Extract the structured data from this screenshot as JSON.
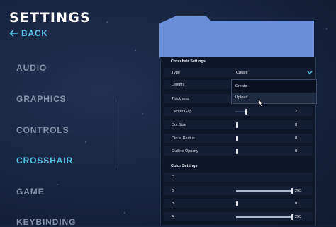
{
  "header": {
    "title": "SETTINGS",
    "back_label": "BACK",
    "back_icon": "arrow-left-icon",
    "accent_color": "#59c6e8"
  },
  "nav": {
    "items": [
      {
        "label": "AUDIO",
        "active": false
      },
      {
        "label": "GRAPHICS",
        "active": false
      },
      {
        "label": "CONTROLS",
        "active": false
      },
      {
        "label": "CROSSHAIR",
        "active": true
      },
      {
        "label": "GAME",
        "active": false
      },
      {
        "label": "KEYBINDING",
        "active": false
      }
    ]
  },
  "crosshair_settings": {
    "title": "Crosshair Settings",
    "type": {
      "label": "Type",
      "selected": "Create",
      "options": [
        "Create",
        "Upload"
      ],
      "hovered_option": "Upload"
    },
    "length": {
      "label": "Length"
    },
    "thickness": {
      "label": "Thickness"
    },
    "center_gap": {
      "label": "Center Gap",
      "value": "2",
      "level": 0.2
    },
    "dot_size": {
      "label": "Dot Size",
      "value": "0",
      "level": 0
    },
    "circle_radius": {
      "label": "Circle Radius",
      "value": "0",
      "level": 0
    },
    "outline_opacity": {
      "label": "Outline Opacity",
      "value": "0",
      "level": 0
    }
  },
  "color_settings": {
    "title": "Color Settings",
    "r": {
      "label": "R",
      "value": "0",
      "level": 0
    },
    "g": {
      "label": "G",
      "value": "255",
      "level": 1
    },
    "b": {
      "label": "B",
      "value": "0",
      "level": 0
    },
    "a": {
      "label": "A",
      "value": "255",
      "level": 1
    }
  }
}
